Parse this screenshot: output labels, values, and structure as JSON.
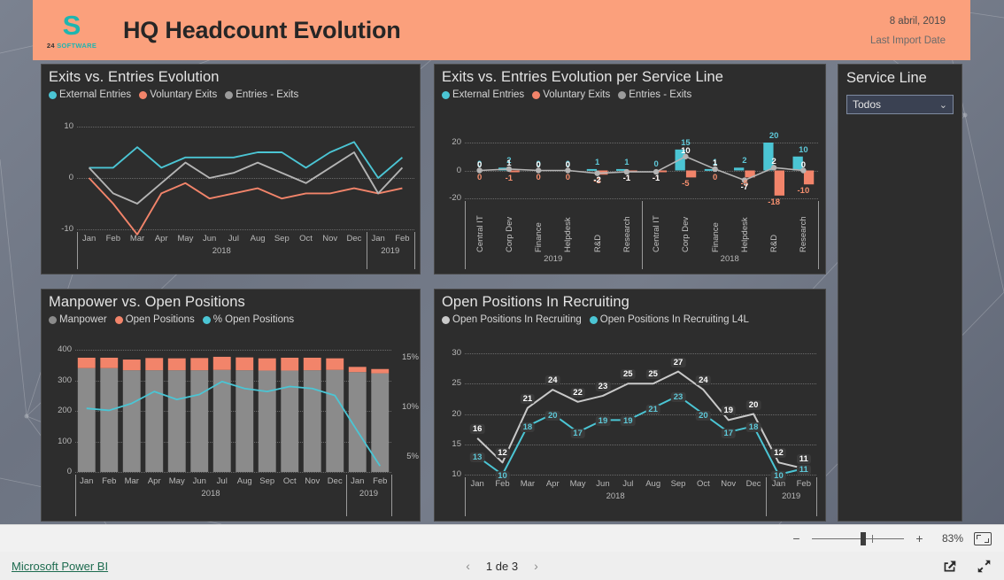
{
  "header": {
    "logo": {
      "mark": "S",
      "prefix": "24",
      "word": "SOFTWARE"
    },
    "title": "HQ Headcount Evolution",
    "date": "8 abril, 2019",
    "date_label": "Last Import Date",
    "bg_color": "#fba07c"
  },
  "colors": {
    "cyan": "#4bc5d4",
    "orange": "#f2846a",
    "gray": "#9b9b9b",
    "card_bg": "#2d2d2d",
    "accent_link": "#1d6b4f"
  },
  "slicer": {
    "title": "Service Line",
    "selected": "Todos",
    "chevron_icon": "chevron-down-icon"
  },
  "footer": {
    "brand": "Microsoft Power BI",
    "page": "1 de 3",
    "prev_icon": "chevron-left-icon",
    "next_icon": "chevron-right-icon",
    "share_icon": "share-icon",
    "fullscreen_icon": "fullscreen-icon",
    "zoom_percent": "83%",
    "zoom_out_icon": "minus-icon",
    "zoom_in_icon": "plus-icon",
    "fit_icon": "fit-to-page-icon"
  },
  "chart_data": [
    {
      "id": "exits-entries-evolution",
      "type": "line",
      "title": "Exits vs. Entries Evolution",
      "categories": [
        "Jan",
        "Feb",
        "Mar",
        "Apr",
        "May",
        "Jun",
        "Jul",
        "Aug",
        "Sep",
        "Oct",
        "Nov",
        "Dec",
        "Jan",
        "Feb"
      ],
      "group_labels": [
        "2018",
        "2019"
      ],
      "group_split_index": 12,
      "ylim": [
        -10,
        10
      ],
      "yticks": [
        10,
        0,
        -10
      ],
      "ytick_labels": [
        "10",
        "0",
        "-10"
      ],
      "grid": true,
      "legend_position": "top",
      "series": [
        {
          "name": "External Entries",
          "color": "#4bc5d4",
          "values": [
            2,
            2,
            6,
            2,
            4,
            4,
            4,
            5,
            5,
            2,
            5,
            7,
            0,
            4
          ]
        },
        {
          "name": "Voluntary Exits",
          "color": "#f2846a",
          "values": [
            0,
            -5,
            -11,
            -3,
            -1,
            -4,
            -3,
            -2,
            -4,
            -3,
            -3,
            -2,
            -3,
            -2
          ]
        },
        {
          "name": "Entries - Exits",
          "color": "#b4b4b4",
          "values": [
            2,
            -3,
            -5,
            -1,
            3,
            0,
            1,
            3,
            1,
            -1,
            2,
            5,
            -3,
            2
          ]
        }
      ]
    },
    {
      "id": "exits-entries-per-service-line",
      "type": "bar",
      "title": "Exits vs. Entries Evolution per Service Line",
      "categories": [
        "Central IT",
        "Corp Dev",
        "Finance",
        "Helpdesk",
        "R&D",
        "Research",
        "Central IT",
        "Corp Dev",
        "Finance",
        "Helpdesk",
        "R&D",
        "Research"
      ],
      "group_labels": [
        "2019",
        "2018"
      ],
      "group_split_index": 6,
      "ylim": [
        -20,
        20
      ],
      "yticks": [
        20,
        0,
        -20
      ],
      "ytick_labels": [
        "20",
        "0",
        "-20"
      ],
      "grid": true,
      "legend_position": "top",
      "series": [
        {
          "name": "External Entries",
          "color": "#4bc5d4",
          "values": [
            0,
            2,
            0,
            0,
            1,
            1,
            0,
            15,
            1,
            2,
            20,
            10
          ]
        },
        {
          "name": "Voluntary Exits",
          "color": "#f2846a",
          "values": [
            0,
            -1,
            0,
            0,
            -3,
            -1,
            -1,
            -5,
            0,
            -5,
            -18,
            -10
          ]
        },
        {
          "name": "Entries - Exits",
          "color": "#b4b4b4",
          "values": [
            0,
            1,
            0,
            0,
            -2,
            -1,
            -1,
            10,
            1,
            -7,
            2,
            0
          ]
        }
      ]
    },
    {
      "id": "manpower-vs-open-positions",
      "type": "bar",
      "title": "Manpower vs. Open Positions",
      "categories": [
        "Jan",
        "Feb",
        "Mar",
        "Apr",
        "May",
        "Jun",
        "Jul",
        "Aug",
        "Sep",
        "Oct",
        "Nov",
        "Dec",
        "Jan",
        "Feb"
      ],
      "group_labels": [
        "2018",
        "2019"
      ],
      "group_split_index": 12,
      "ylim": [
        0,
        400
      ],
      "yticks": [
        400,
        300,
        200,
        100,
        0
      ],
      "ytick_labels": [
        "400",
        "300",
        "200",
        "100",
        "0"
      ],
      "y2lim": [
        3.5,
        15.8
      ],
      "y2ticks": [
        15,
        10,
        5
      ],
      "y2tick_labels": [
        "15%",
        "10%",
        "5%"
      ],
      "grid": true,
      "legend_position": "top",
      "series": [
        {
          "name": "Manpower",
          "color": "#8b8b8b",
          "stack": "total",
          "values": [
            340,
            340,
            333,
            333,
            333,
            333,
            334,
            333,
            332,
            332,
            333,
            334,
            327,
            323
          ]
        },
        {
          "name": "Open Positions",
          "color": "#f2846a",
          "stack": "total",
          "values": [
            34,
            34,
            35,
            40,
            39,
            40,
            43,
            42,
            40,
            42,
            41,
            38,
            17,
            14
          ]
        },
        {
          "name": "% Open Positions",
          "color": "#4bc5d4",
          "axis": "right",
          "values": [
            9.9,
            9.7,
            10.4,
            11.6,
            10.8,
            11.3,
            12.6,
            11.9,
            11.6,
            12.1,
            11.9,
            11.2,
            7.6,
            4.1
          ]
        }
      ]
    },
    {
      "id": "open-positions-in-recruiting",
      "type": "line",
      "title": "Open Positions In Recruiting",
      "categories": [
        "Jan",
        "Feb",
        "Mar",
        "Apr",
        "May",
        "Jun",
        "Jul",
        "Aug",
        "Sep",
        "Oct",
        "Nov",
        "Dec",
        "Jan",
        "Feb"
      ],
      "group_labels": [
        "2018",
        "2019"
      ],
      "group_split_index": 12,
      "ylim": [
        10,
        30
      ],
      "yticks": [
        30,
        25,
        20,
        15,
        10
      ],
      "ytick_labels": [
        "30",
        "25",
        "20",
        "15",
        "10"
      ],
      "grid": true,
      "legend_position": "top",
      "series": [
        {
          "name": "Open Positions In Recruiting",
          "color": "#c9c9c9",
          "values": [
            16,
            12,
            21,
            24,
            22,
            23,
            25,
            25,
            27,
            24,
            19,
            20,
            12,
            11
          ]
        },
        {
          "name": "Open Positions In Recruiting L4L",
          "color": "#4bc5d4",
          "values": [
            13,
            10,
            18,
            20,
            17,
            19,
            19,
            21,
            23,
            20,
            17,
            18,
            10,
            11
          ]
        }
      ]
    }
  ]
}
